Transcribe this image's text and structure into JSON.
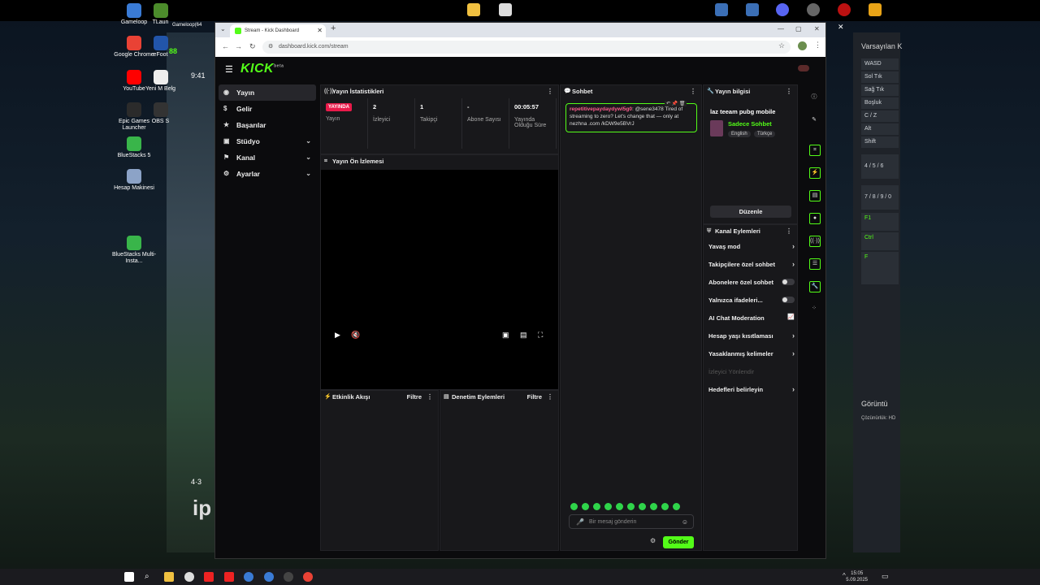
{
  "desktop": {
    "icons": [
      {
        "label": "Gameloop",
        "color": "#3a7bd5"
      },
      {
        "label": "Google Chrome",
        "color": "#e94235"
      },
      {
        "label": "YouTube",
        "color": "#ff0000"
      },
      {
        "label": "Epic Games Launcher",
        "color": "#2b2b2b"
      },
      {
        "label": "BlueStacks 5",
        "color": "#39b54a"
      },
      {
        "label": "Hesap Makinesi",
        "color": "#8ca3c7"
      },
      {
        "label": "BlueStacks Multi-Insta...",
        "color": "#39b54a"
      }
    ],
    "col2": [
      {
        "label": "TLaun",
        "color": "#4c8c2b"
      },
      {
        "label": "eFoot",
        "color": "#2255aa"
      },
      {
        "label": "Yeni M Belg",
        "color": "#eeeeee"
      },
      {
        "label": "OBS S",
        "color": "#333333"
      }
    ],
    "gameloop_window": "Gameloop(64",
    "game_hud_time": "9:41",
    "game_hud_num": "88",
    "game_hud_count": "4·3",
    "game_hud_ip": "ip"
  },
  "right_panel": {
    "title": "Varsayılan K",
    "keys": [
      "WASD",
      "Sol Tık",
      "Sağ Tık",
      "Boşluk",
      "C / Z",
      "Alt",
      "Shift"
    ],
    "nums": [
      "4 / 5 / 6",
      "7 / 8 / 9 / 0"
    ],
    "fkeys": [
      "F1",
      "Ctrl",
      "F"
    ],
    "display_title": "Görüntü",
    "resolution": "Çözünürlük: HD"
  },
  "browser": {
    "tab_title": "Stream - Kick Dashboard",
    "url": "dashboard.kick.com/stream"
  },
  "app": {
    "logo": "KICK",
    "logo_sup": "beta",
    "sidebar": [
      {
        "label": "Yayın",
        "icon": "◉",
        "active": true
      },
      {
        "label": "Gelir",
        "icon": "$"
      },
      {
        "label": "Başarılar",
        "icon": "★"
      },
      {
        "label": "Stüdyo",
        "icon": "▣",
        "caret": true
      },
      {
        "label": "Kanal",
        "icon": "⚑",
        "caret": true
      },
      {
        "label": "Ayarlar",
        "icon": "⚙",
        "caret": true
      }
    ],
    "stats": {
      "title": "Yayın İstatistikleri",
      "live_badge": "YAYINDA",
      "items": [
        {
          "value": "",
          "label": "Yayın"
        },
        {
          "value": "2",
          "label": "İzleyici"
        },
        {
          "value": "1",
          "label": "Takipçi"
        },
        {
          "value": "-",
          "label": "Abone Sayısı"
        },
        {
          "value": "00:05:57",
          "label": "Yayında Olduğu Süre"
        }
      ]
    },
    "preview": {
      "title": "Yayın Ön İzlemesi"
    },
    "activity": {
      "title": "Etkinlik Akışı",
      "filter": "Filtre"
    },
    "moderation": {
      "title": "Denetim Eylemleri",
      "filter": "Filtre"
    },
    "chat": {
      "title": "Sohbet",
      "message_user": "repetitivepaydaydywl5g0",
      "message_text": ": @sene3478 Tired of streaming to zero? Let's change that — only at nezhna .com /kDW9e5BVrJ",
      "placeholder": "Bir mesaj gönderin",
      "send": "Gönder"
    },
    "info": {
      "title": "Yayın bilgisi",
      "stream_title": "laz teeam pubg mobile",
      "category": "Sadece Sohbet",
      "tags": [
        "English",
        "Türkçe"
      ],
      "edit": "Düzenle"
    },
    "channel_actions": {
      "title": "Kanal Eylemleri",
      "rows": [
        {
          "label": "Yavaş mod",
          "kind": "arrow"
        },
        {
          "label": "Takipçilere özel sohbet",
          "kind": "arrow"
        },
        {
          "label": "Abonelere özel sohbet",
          "kind": "toggle"
        },
        {
          "label": "Yalnızca ifadeleri...",
          "kind": "toggle"
        },
        {
          "label": "AI Chat Moderation",
          "kind": "chart"
        },
        {
          "label": "Hesap yaşı kısıtlaması",
          "kind": "arrow"
        },
        {
          "label": "Yasaklanmış kelimeler",
          "kind": "arrow"
        },
        {
          "label": "İzleyici Yönlendir",
          "kind": "dim"
        },
        {
          "label": "Hedefleri belirleyin",
          "kind": "arrow"
        }
      ]
    }
  },
  "taskbar": {
    "time": "15:05",
    "date": "5.09.2025"
  }
}
